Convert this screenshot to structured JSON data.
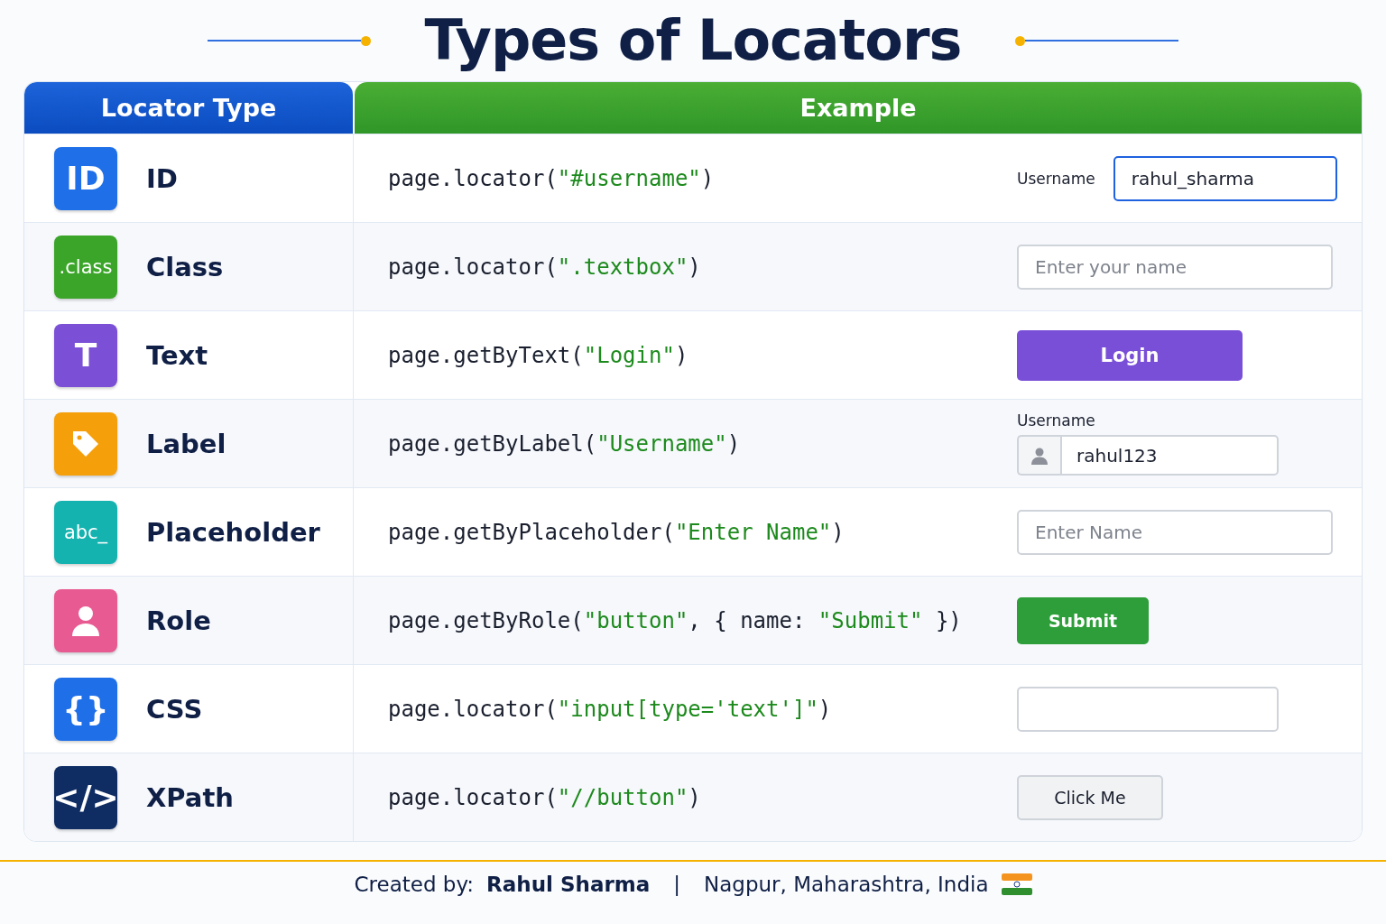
{
  "title": "Types of Locators",
  "table": {
    "columns": [
      "Locator Type",
      "Example"
    ],
    "rows": [
      {
        "icon": {
          "kind": "glyph",
          "glyph": "ID",
          "color": "#1e6fe8"
        },
        "name": "ID",
        "code": [
          {
            "kind": "plain",
            "text": "page.locator("
          },
          {
            "kind": "string",
            "text": "\"#username\""
          },
          {
            "kind": "plain",
            "text": ")"
          }
        ],
        "example": {
          "kind": "labeled-input",
          "label": "Username",
          "value": "rahul_sharma",
          "focused": true
        }
      },
      {
        "icon": {
          "kind": "glyph",
          "glyph": ".class",
          "color": "#3aa528"
        },
        "name": "Class",
        "code": [
          {
            "kind": "plain",
            "text": "page.locator("
          },
          {
            "kind": "string",
            "text": "\".textbox\""
          },
          {
            "kind": "plain",
            "text": ")"
          }
        ],
        "example": {
          "kind": "input",
          "placeholder": "Enter your name"
        }
      },
      {
        "icon": {
          "kind": "glyph",
          "glyph": "T",
          "color": "#7b4fd6"
        },
        "name": "Text",
        "code": [
          {
            "kind": "plain",
            "text": "page.getByText("
          },
          {
            "kind": "string",
            "text": "\"Login\""
          },
          {
            "kind": "plain",
            "text": ")"
          }
        ],
        "example": {
          "kind": "button",
          "label": "Login",
          "color": "#7a4fd8"
        }
      },
      {
        "icon": {
          "kind": "tag",
          "color": "#f59f0a"
        },
        "name": "Label",
        "code": [
          {
            "kind": "plain",
            "text": "page.getByLabel("
          },
          {
            "kind": "string",
            "text": "\"Username\""
          },
          {
            "kind": "plain",
            "text": ")"
          }
        ],
        "example": {
          "kind": "label-above-input",
          "label": "Username",
          "value": "rahul123"
        }
      },
      {
        "icon": {
          "kind": "glyph",
          "glyph": "abc_",
          "color": "#14b3b0"
        },
        "name": "Placeholder",
        "code": [
          {
            "kind": "plain",
            "text": "page.getByPlaceholder("
          },
          {
            "kind": "string",
            "text": "\"Enter Name\""
          },
          {
            "kind": "plain",
            "text": ")"
          }
        ],
        "example": {
          "kind": "input",
          "placeholder": "Enter Name"
        }
      },
      {
        "icon": {
          "kind": "person",
          "color": "#e85a92"
        },
        "name": "Role",
        "code": [
          {
            "kind": "plain",
            "text": "page.getByRole("
          },
          {
            "kind": "string",
            "text": "\"button\""
          },
          {
            "kind": "plain",
            "text": ", { name: "
          },
          {
            "kind": "string",
            "text": "\"Submit\""
          },
          {
            "kind": "plain",
            "text": " })"
          }
        ],
        "example": {
          "kind": "small-button",
          "label": "Submit",
          "color": "#2e9e3a"
        }
      },
      {
        "icon": {
          "kind": "glyph",
          "glyph": "{}",
          "color": "#1e6fe8"
        },
        "name": "CSS",
        "code": [
          {
            "kind": "plain",
            "text": "page.locator("
          },
          {
            "kind": "string",
            "text": "\"input[type='text']\""
          },
          {
            "kind": "plain",
            "text": ")"
          }
        ],
        "example": {
          "kind": "empty-input"
        }
      },
      {
        "icon": {
          "kind": "glyph",
          "glyph": "</>",
          "color": "#0f2d63"
        },
        "name": "XPath",
        "code": [
          {
            "kind": "plain",
            "text": "page.locator("
          },
          {
            "kind": "string",
            "text": "\"//button\""
          },
          {
            "kind": "plain",
            "text": ")"
          }
        ],
        "example": {
          "kind": "plain-button",
          "label": "Click Me"
        }
      }
    ]
  },
  "footer": {
    "credit_label": "Created by:",
    "author": "Rahul Sharma",
    "separator": "|",
    "location": "Nagpur, Maharashtra, India"
  }
}
